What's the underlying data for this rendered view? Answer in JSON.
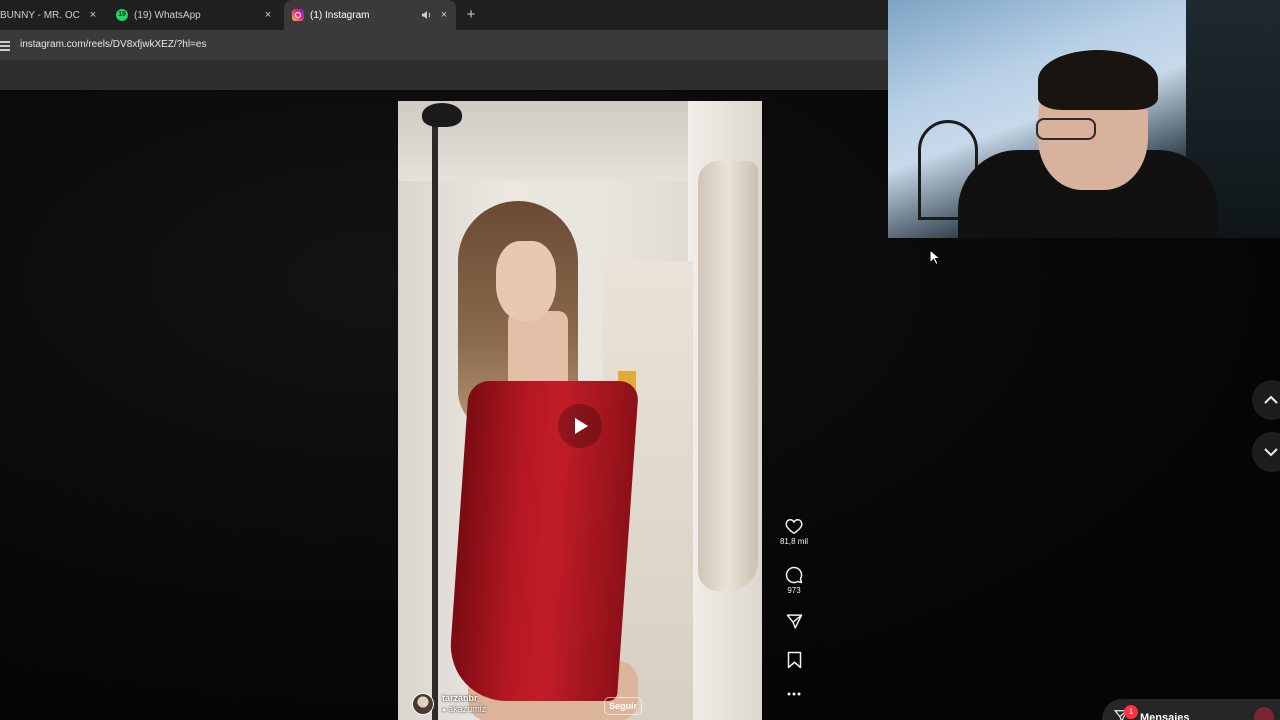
{
  "browser": {
    "tabs": [
      {
        "title": "BUNNY - MR. OCTOBER",
        "favicon": "music-icon",
        "active": false
      },
      {
        "title": "(19) WhatsApp",
        "favicon": "whatsapp-icon",
        "badge": "19",
        "active": false
      },
      {
        "title": "(1) Instagram",
        "favicon": "instagram-icon",
        "active": true,
        "audio": "speaker-icon"
      }
    ],
    "new_tab": "+",
    "close_glyph": "×",
    "url": "instagram.com/reels/DV8xfjwkXEZ/?hl=es"
  },
  "reel": {
    "author_name": "tarzanbr_",
    "audio_credit": "akazumiz",
    "follow_label": "Seguir",
    "actions": [
      {
        "name": "like",
        "icon": "heart-icon",
        "count": "81,8 mil"
      },
      {
        "name": "comment",
        "icon": "comment-icon",
        "count": "973"
      },
      {
        "name": "share",
        "icon": "send-icon",
        "count": ""
      },
      {
        "name": "save",
        "icon": "bookmark-icon",
        "count": ""
      },
      {
        "name": "more",
        "icon": "more-icon",
        "count": ""
      }
    ]
  },
  "navigation": {
    "up": "chevron-up-icon",
    "down": "chevron-down-icon"
  },
  "messages": {
    "label": "Mensajes",
    "badge": "1"
  },
  "colors": {
    "accent": "#ff3040",
    "chrome_dark": "#1f1f1f",
    "chrome_active": "#3a3a3a",
    "dress_red": "#b41822"
  }
}
